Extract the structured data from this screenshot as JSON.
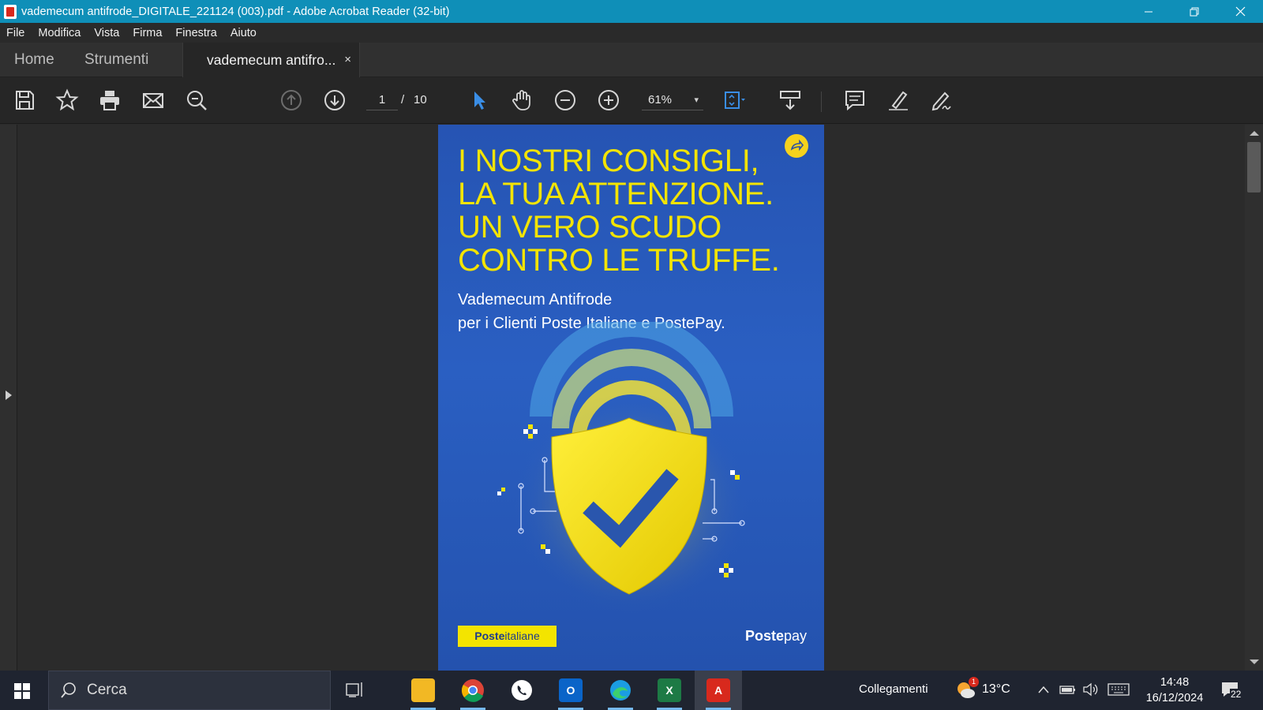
{
  "window": {
    "title": "vademecum antifrode_DIGITALE_221124 (003).pdf - Adobe Acrobat Reader (32-bit)",
    "controls": [
      "minimize",
      "restore",
      "close"
    ]
  },
  "menu": [
    "File",
    "Modifica",
    "Vista",
    "Firma",
    "Finestra",
    "Aiuto"
  ],
  "tabs": {
    "home": "Home",
    "tools": "Strumenti",
    "doc": "vademecum antifro...",
    "close": "×"
  },
  "toolbar": {
    "page_current": "1",
    "page_sep": "/",
    "page_total": "10",
    "zoom": "61%",
    "zoom_caret": "▾"
  },
  "document": {
    "headline": [
      "I NOSTRI CONSIGLI,",
      "LA TUA ATTENZIONE.",
      "UN VERO SCUDO",
      "CONTRO LE TRUFFE."
    ],
    "subtitle": [
      "Vademecum Antifrode",
      "per i Clienti Poste Italiane e PostePay."
    ],
    "logo_poste_bold": "Poste",
    "logo_poste_regular": "italiane",
    "logo_postepay_bold": "Poste",
    "logo_postepay_regular": "pay",
    "colors": {
      "page_blue": "#2654b3",
      "accent_yellow": "#f3e400"
    }
  },
  "taskbar": {
    "search_placeholder": "Cerca",
    "links_label": "Collegamenti",
    "temperature": "13°C",
    "weather_badge": "1",
    "time": "14:48",
    "date": "16/12/2024",
    "notifications": "22"
  }
}
